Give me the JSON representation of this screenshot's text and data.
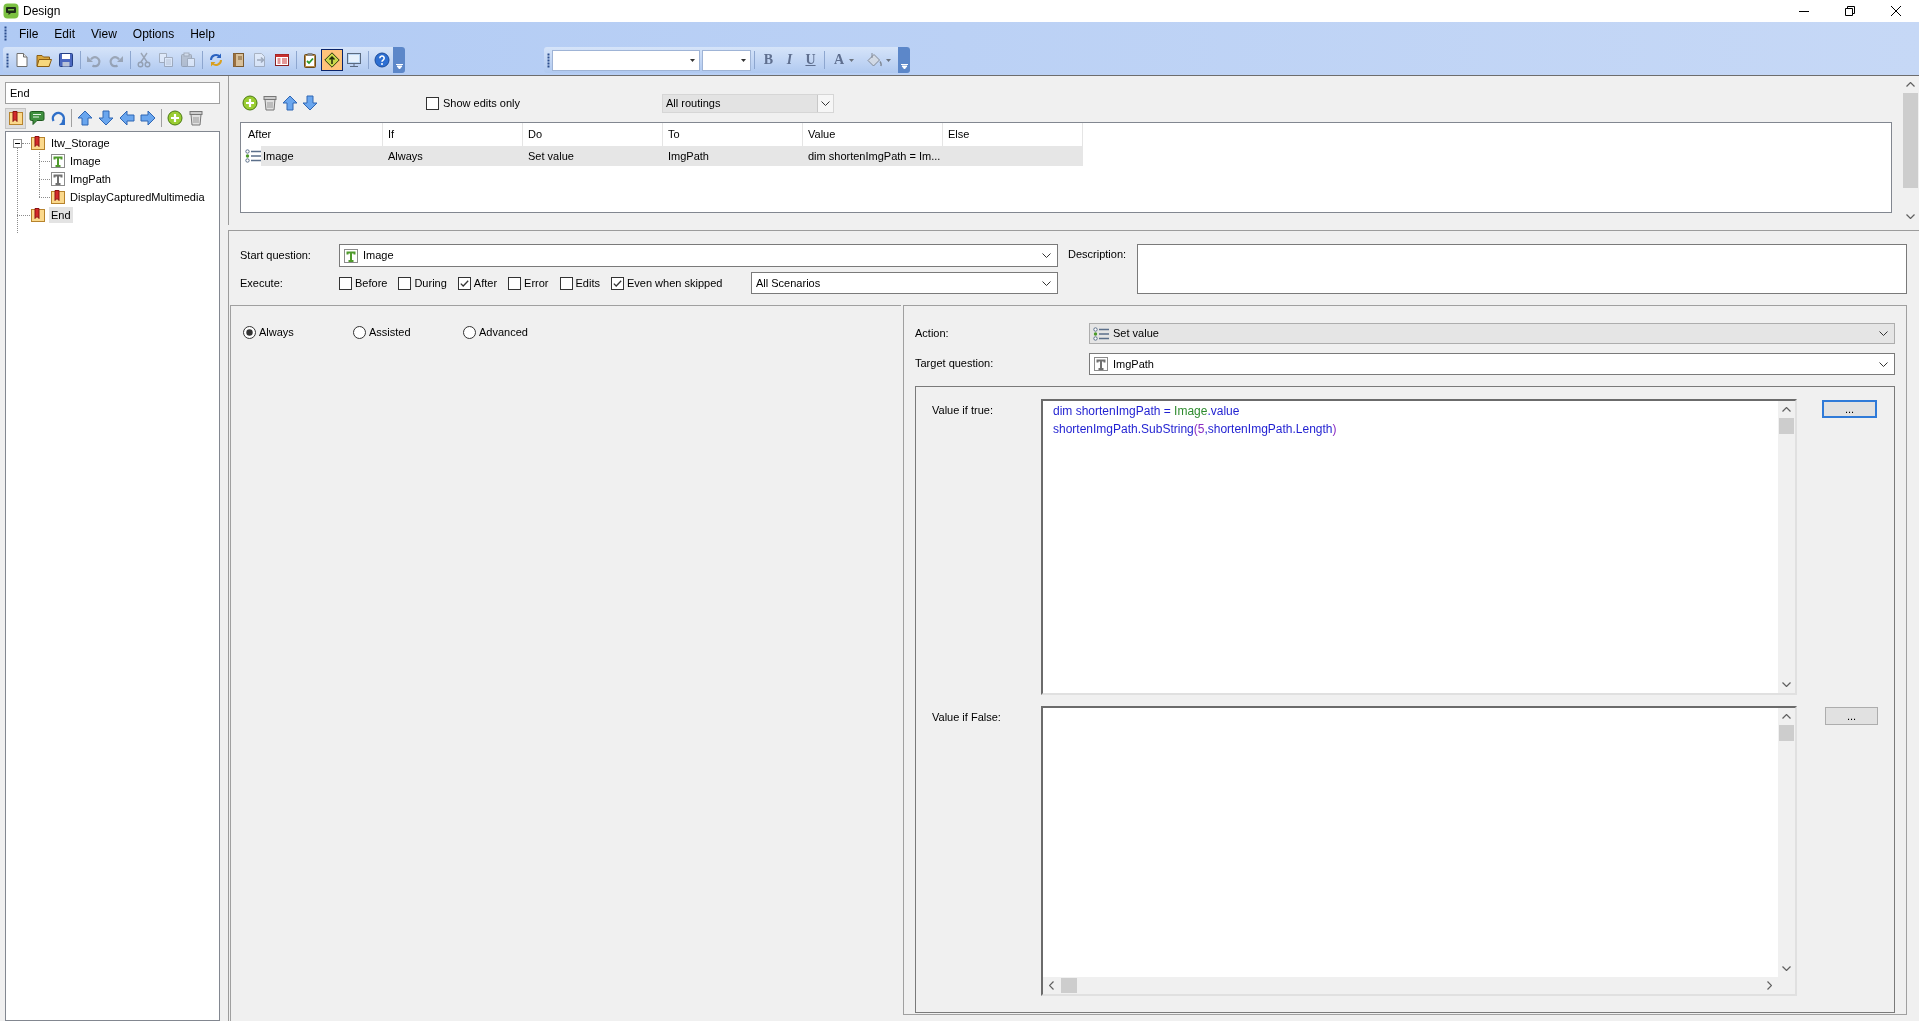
{
  "window": {
    "title": "Design"
  },
  "menu": [
    {
      "label": "File"
    },
    {
      "label": "Edit"
    },
    {
      "label": "View"
    },
    {
      "label": "Options"
    },
    {
      "label": "Help"
    }
  ],
  "main_toolbar": {
    "groups": [
      {
        "buttons": [
          {
            "kind": "new",
            "disabled": false,
            "pressed": false
          },
          {
            "kind": "open",
            "disabled": false,
            "pressed": false
          },
          {
            "kind": "save",
            "disabled": false,
            "pressed": false
          }
        ]
      },
      {
        "buttons": [
          {
            "kind": "undo",
            "disabled": true,
            "pressed": false
          },
          {
            "kind": "redo",
            "disabled": true,
            "pressed": false
          }
        ]
      },
      {
        "buttons": [
          {
            "kind": "cut",
            "disabled": true,
            "pressed": false
          },
          {
            "kind": "copy",
            "disabled": true,
            "pressed": false
          },
          {
            "kind": "paste",
            "disabled": true,
            "pressed": false
          }
        ]
      },
      {
        "buttons": [
          {
            "kind": "cycle",
            "disabled": false,
            "pressed": false
          },
          {
            "kind": "notebook",
            "disabled": false,
            "pressed": false
          },
          {
            "kind": "export",
            "disabled": true,
            "pressed": false
          },
          {
            "kind": "form",
            "disabled": false,
            "pressed": false
          }
        ]
      },
      {
        "buttons": [
          {
            "kind": "checklist",
            "disabled": false,
            "pressed": false
          },
          {
            "kind": "routing",
            "disabled": false,
            "pressed": true
          },
          {
            "kind": "preview",
            "disabled": false,
            "pressed": false
          }
        ]
      },
      {
        "buttons": [
          {
            "kind": "help",
            "disabled": false,
            "pressed": false
          }
        ]
      }
    ]
  },
  "format_toolbar": {
    "buttons": [
      {
        "kind": "bold",
        "label": "B",
        "disabled": true
      },
      {
        "kind": "italic",
        "label": "I",
        "disabled": true
      },
      {
        "kind": "underline",
        "label": "U",
        "disabled": true
      },
      {
        "kind": "font_color",
        "label": "A",
        "disabled": true
      },
      {
        "kind": "fill_color",
        "disabled": true
      }
    ]
  },
  "search": {
    "value": "End"
  },
  "tree_toolbar": {
    "groups": [
      {
        "buttons": [
          {
            "kind": "bookmark",
            "pressed": true
          },
          {
            "kind": "comment",
            "pressed": false
          },
          {
            "kind": "loop",
            "pressed": false
          }
        ]
      },
      {
        "buttons": [
          {
            "kind": "up",
            "pressed": false
          },
          {
            "kind": "down",
            "pressed": false
          },
          {
            "kind": "left",
            "pressed": false
          },
          {
            "kind": "right",
            "pressed": false
          }
        ]
      },
      {
        "buttons": [
          {
            "kind": "add",
            "pressed": false
          },
          {
            "kind": "delete",
            "pressed": false
          }
        ]
      }
    ]
  },
  "tree": [
    {
      "kind": "block",
      "label": "Itw_Storage",
      "expanded": true,
      "selected": false,
      "children": [
        {
          "kind": "question",
          "label": "Image",
          "color": "#4f9a2c",
          "selected": false
        },
        {
          "kind": "question",
          "label": "ImgPath",
          "color": "#707070",
          "selected": false
        },
        {
          "kind": "block",
          "label": "DisplayCapturedMultimedia",
          "selected": false
        }
      ]
    },
    {
      "kind": "block",
      "label": "End",
      "selected": true
    }
  ],
  "routing": {
    "toolbar": [
      {
        "kind": "add"
      },
      {
        "kind": "delete"
      },
      {
        "kind": "up"
      },
      {
        "kind": "down"
      }
    ],
    "show_edits_only": {
      "label": "Show edits only",
      "checked": false
    },
    "filter": {
      "value": "All routings"
    },
    "columns": [
      "After",
      "If",
      "Do",
      "To",
      "Value",
      "Else"
    ],
    "rows": [
      {
        "selected": true,
        "cells": [
          "Image",
          "Always",
          "Set value",
          "ImgPath",
          "dim shortenImgPath = Im..."
        ]
      }
    ]
  },
  "start_question": {
    "label": "Start question:",
    "value": "Image"
  },
  "execute": {
    "label": "Execute:",
    "options": [
      {
        "label": "Before",
        "checked": false
      },
      {
        "label": "During",
        "checked": false
      },
      {
        "label": "After",
        "checked": true
      },
      {
        "label": "Error",
        "checked": false
      },
      {
        "label": "Edits",
        "checked": false
      },
      {
        "label": "Even when skipped",
        "checked": true
      }
    ],
    "scenario": {
      "value": "All Scenarios"
    }
  },
  "description": {
    "label": "Description:"
  },
  "mode": [
    {
      "label": "Always",
      "selected": true
    },
    {
      "label": "Assisted",
      "selected": false
    },
    {
      "label": "Advanced",
      "selected": false
    }
  ],
  "action": {
    "label": "Action:",
    "value": "Set value"
  },
  "target_question": {
    "label": "Target question:",
    "value": "ImgPath"
  },
  "value_if_true": {
    "label": "Value if true:",
    "lines": [
      {
        "tokens": [
          {
            "kind": "plain",
            "text": "dim shortenImgPath = "
          },
          {
            "kind": "reference",
            "text": "Image"
          },
          {
            "kind": "plain",
            "text": ".value"
          }
        ]
      },
      {
        "tokens": [
          {
            "kind": "plain",
            "text": "shortenImgPath.SubString"
          },
          {
            "kind": "bracket",
            "text": "("
          },
          {
            "kind": "number",
            "text": "5"
          },
          {
            "kind": "plain",
            "text": ",shortenImgPath.Length"
          },
          {
            "kind": "bracket",
            "text": ")"
          }
        ]
      }
    ],
    "button": {
      "label": "...",
      "focused": true
    }
  },
  "value_if_false": {
    "label": "Value if False:",
    "button": {
      "label": "...",
      "focused": false
    }
  }
}
